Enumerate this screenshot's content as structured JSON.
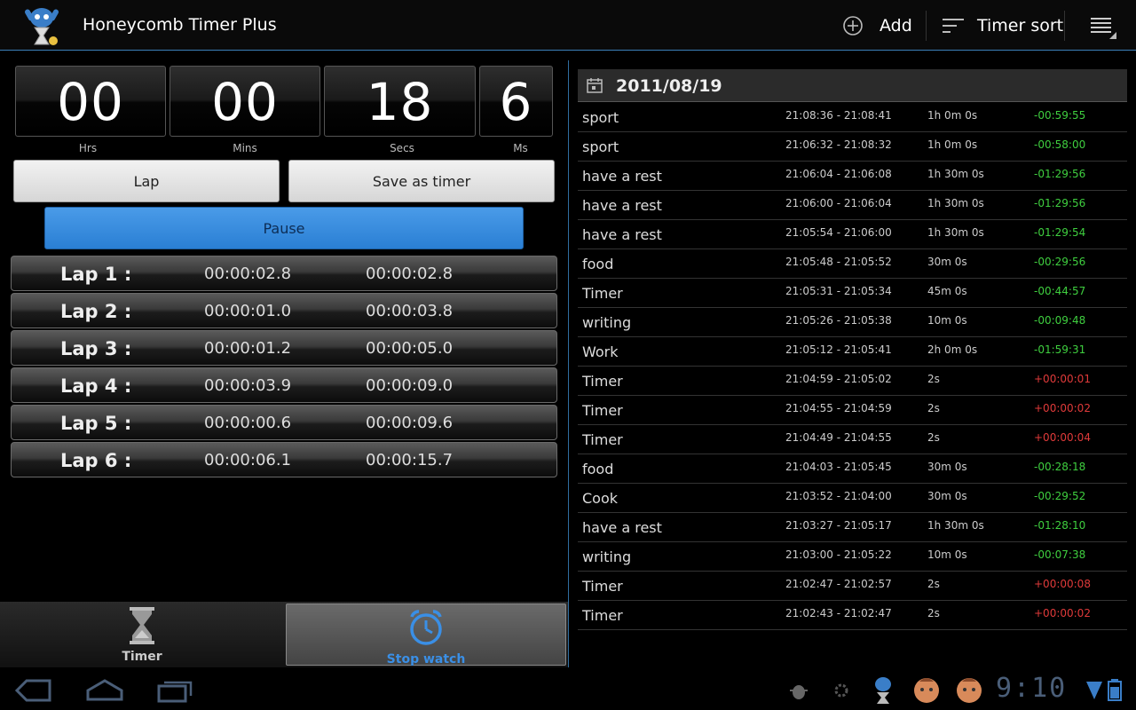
{
  "app": {
    "title": "Honeycomb Timer Plus",
    "accent": "#3b7fb8"
  },
  "actionbar": {
    "add_label": "Add",
    "sort_label": "Timer sort"
  },
  "stopwatch": {
    "hours": "00",
    "hours_label": "Hrs",
    "mins": "00",
    "mins_label": "Mins",
    "secs": "18",
    "secs_label": "Secs",
    "ms": "6",
    "ms_label": "Ms"
  },
  "buttons": {
    "lap": "Lap",
    "save_as_timer": "Save as timer",
    "pause": "Pause"
  },
  "laps": [
    {
      "label": "Lap 1 :",
      "split": "00:00:02.8",
      "total": "00:00:02.8"
    },
    {
      "label": "Lap 2 :",
      "split": "00:00:01.0",
      "total": "00:00:03.8"
    },
    {
      "label": "Lap 3 :",
      "split": "00:00:01.2",
      "total": "00:00:05.0"
    },
    {
      "label": "Lap 4 :",
      "split": "00:00:03.9",
      "total": "00:00:09.0"
    },
    {
      "label": "Lap 5 :",
      "split": "00:00:00.6",
      "total": "00:00:09.6"
    },
    {
      "label": "Lap 6 :",
      "split": "00:00:06.1",
      "total": "00:00:15.7"
    }
  ],
  "tabs": {
    "timer": "Timer",
    "stopwatch": "Stop watch"
  },
  "history": {
    "date": "2011/08/19",
    "rows": [
      {
        "name": "sport",
        "range": "21:08:36 - 21:08:41",
        "duration": "1h 0m 0s",
        "diff": "-00:59:55",
        "sign": "neg"
      },
      {
        "name": "sport",
        "range": "21:06:32 - 21:08:32",
        "duration": "1h 0m 0s",
        "diff": "-00:58:00",
        "sign": "neg"
      },
      {
        "name": "have a rest",
        "range": "21:06:04 - 21:06:08",
        "duration": "1h 30m 0s",
        "diff": "-01:29:56",
        "sign": "neg"
      },
      {
        "name": "have a rest",
        "range": "21:06:00 - 21:06:04",
        "duration": "1h 30m 0s",
        "diff": "-01:29:56",
        "sign": "neg"
      },
      {
        "name": "have a rest",
        "range": "21:05:54 - 21:06:00",
        "duration": "1h 30m 0s",
        "diff": "-01:29:54",
        "sign": "neg"
      },
      {
        "name": "food",
        "range": "21:05:48 - 21:05:52",
        "duration": "30m 0s",
        "diff": "-00:29:56",
        "sign": "neg"
      },
      {
        "name": "Timer",
        "range": "21:05:31 - 21:05:34",
        "duration": "45m 0s",
        "diff": "-00:44:57",
        "sign": "neg"
      },
      {
        "name": "writing",
        "range": "21:05:26 - 21:05:38",
        "duration": "10m 0s",
        "diff": "-00:09:48",
        "sign": "neg"
      },
      {
        "name": "Work",
        "range": "21:05:12 - 21:05:41",
        "duration": "2h 0m 0s",
        "diff": "-01:59:31",
        "sign": "neg"
      },
      {
        "name": "Timer",
        "range": "21:04:59 - 21:05:02",
        "duration": "2s",
        "diff": "+00:00:01",
        "sign": "pos"
      },
      {
        "name": "Timer",
        "range": "21:04:55 - 21:04:59",
        "duration": "2s",
        "diff": "+00:00:02",
        "sign": "pos"
      },
      {
        "name": "Timer",
        "range": "21:04:49 - 21:04:55",
        "duration": "2s",
        "diff": "+00:00:04",
        "sign": "pos"
      },
      {
        "name": "food",
        "range": "21:04:03 - 21:05:45",
        "duration": "30m 0s",
        "diff": "-00:28:18",
        "sign": "neg"
      },
      {
        "name": "Cook",
        "range": "21:03:52 - 21:04:00",
        "duration": "30m 0s",
        "diff": "-00:29:52",
        "sign": "neg"
      },
      {
        "name": "have a rest",
        "range": "21:03:27 - 21:05:17",
        "duration": "1h 30m 0s",
        "diff": "-01:28:10",
        "sign": "neg"
      },
      {
        "name": "writing",
        "range": "21:03:00 - 21:05:22",
        "duration": "10m 0s",
        "diff": "-00:07:38",
        "sign": "neg"
      },
      {
        "name": "Timer",
        "range": "21:02:47 - 21:02:57",
        "duration": "2s",
        "diff": "+00:00:08",
        "sign": "pos"
      },
      {
        "name": "Timer",
        "range": "21:02:43 - 21:02:47",
        "duration": "2s",
        "diff": "+00:00:02",
        "sign": "pos"
      }
    ]
  },
  "colors": {
    "negative": "#3fcf3f",
    "positive": "#e03a3a",
    "tab_active": "#3a8fe6"
  },
  "system": {
    "clock": "9:10"
  }
}
